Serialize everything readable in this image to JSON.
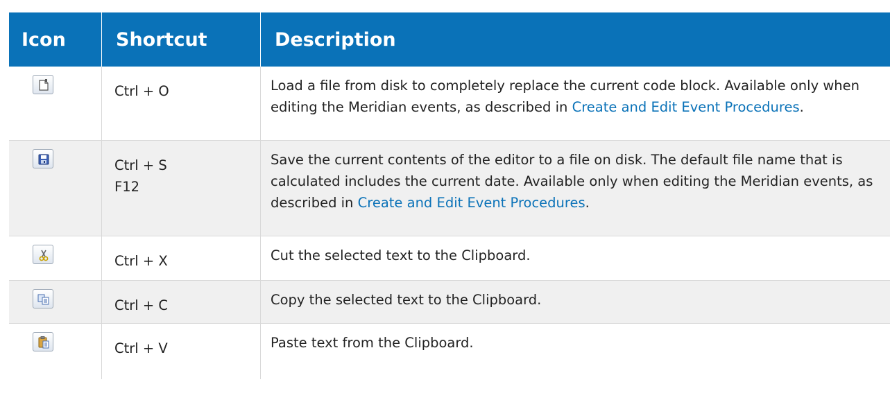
{
  "table": {
    "headers": {
      "icon": "Icon",
      "shortcut": "Shortcut",
      "description": "Description"
    },
    "rows": [
      {
        "icon": "open-file-icon",
        "shortcut_lines": [
          "Ctrl + O"
        ],
        "description_text": "Load a file from disk to completely replace the current code block. Available only when editing the Meridian events, as described in ",
        "description_link": "Create and Edit Event Procedures",
        "description_tail": "."
      },
      {
        "icon": "save-icon",
        "shortcut_lines": [
          "Ctrl + S",
          "F12"
        ],
        "description_text": "Save the current contents of the editor to a file on disk. The default file name that is calculated includes the current date. Available only when editing the Meridian events, as described in ",
        "description_link": "Create and Edit Event Procedures",
        "description_tail": "."
      },
      {
        "icon": "cut-icon",
        "shortcut_lines": [
          "Ctrl + X"
        ],
        "description_text": "Cut the selected text to the Clipboard."
      },
      {
        "icon": "copy-icon",
        "shortcut_lines": [
          "Ctrl + C"
        ],
        "description_text": "Copy the selected text to the Clipboard."
      },
      {
        "icon": "paste-icon",
        "shortcut_lines": [
          "Ctrl + V"
        ],
        "description_text": "Paste text from the Clipboard."
      }
    ]
  },
  "colors": {
    "header_bg": "#0a72b8",
    "link": "#0a72b8",
    "alt_row_bg": "#f0f0f0"
  }
}
